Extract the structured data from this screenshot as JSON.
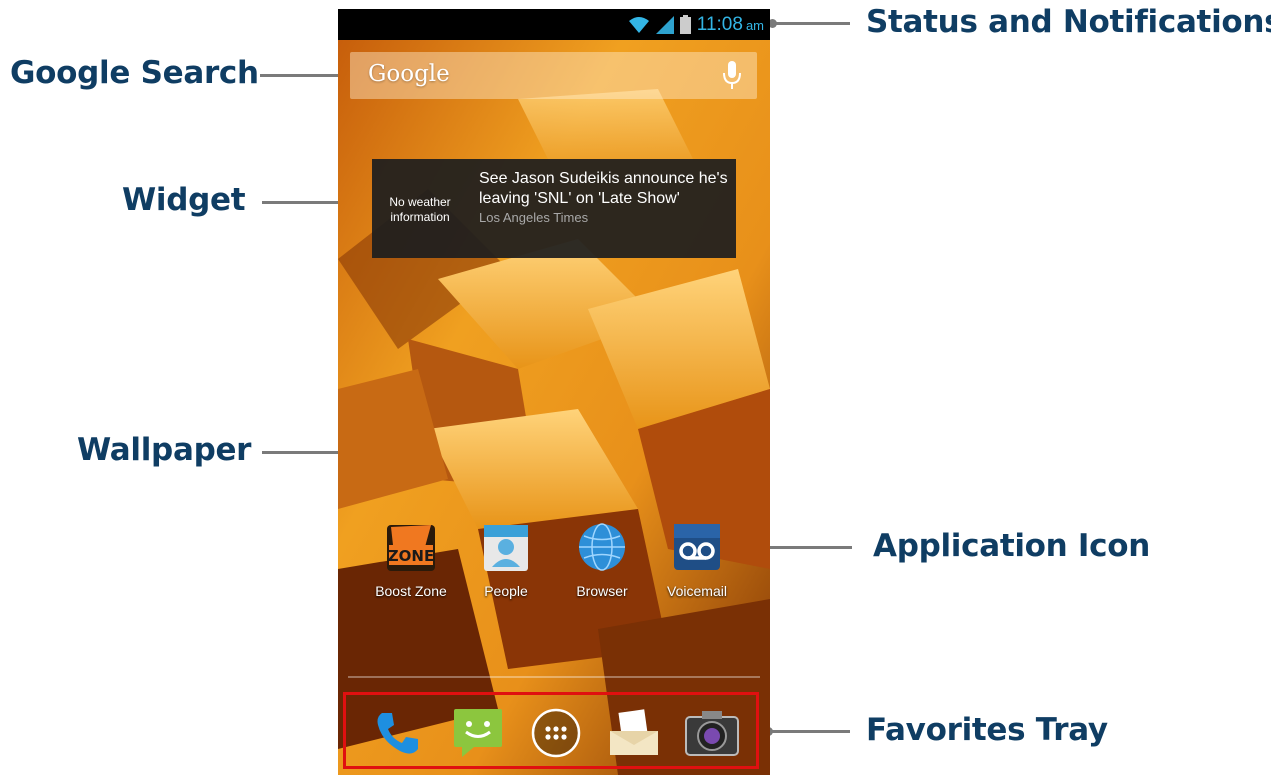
{
  "callouts": {
    "status": "Status and Notifications",
    "google_search": "Google Search",
    "widget": "Widget",
    "wallpaper": "Wallpaper",
    "app_icon": "Application Icon",
    "favorites": "Favorites Tray"
  },
  "status_bar": {
    "time": "11:08",
    "ampm": "am",
    "icons": [
      "wifi-icon",
      "signal-icon",
      "battery-icon"
    ],
    "clock_color": "#33b5e5"
  },
  "search": {
    "label": "Google",
    "icon": "mic-icon"
  },
  "widget": {
    "weather": "No weather information",
    "headline": "See Jason Sudeikis announce he's leaving 'SNL' on 'Late Show'",
    "source": "Los Angeles Times"
  },
  "apps": [
    {
      "label": "Boost Zone",
      "icon": "boost-zone-icon"
    },
    {
      "label": "People",
      "icon": "people-icon"
    },
    {
      "label": "Browser",
      "icon": "browser-icon"
    },
    {
      "label": "Voicemail",
      "icon": "voicemail-icon"
    }
  ],
  "tray": [
    "phone-icon",
    "messaging-icon",
    "app-drawer-icon",
    "email-icon",
    "camera-icon"
  ],
  "colors": {
    "callout_text": "#0f3d63",
    "tray_border": "#e01010",
    "wallpaper": "#f0a020"
  }
}
